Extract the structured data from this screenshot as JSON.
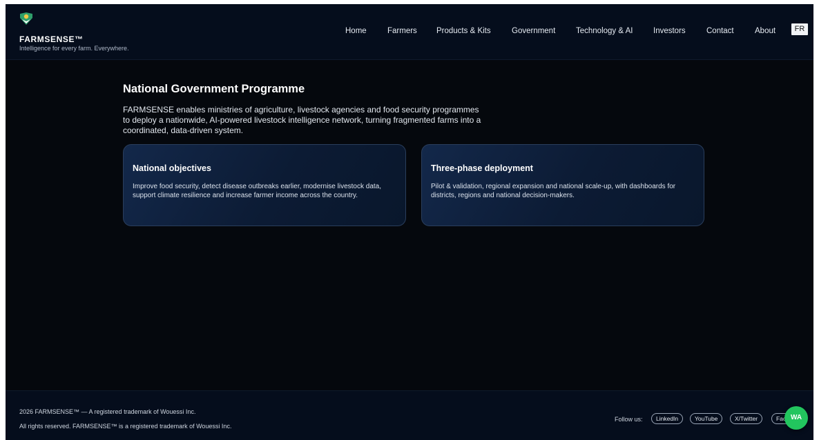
{
  "header": {
    "brand": "FARMSENSE™",
    "tagline": "Intelligence for every farm. Everywhere.",
    "nav": [
      "Home",
      "Farmers",
      "Products & Kits",
      "Government",
      "Technology & AI",
      "Investors",
      "Contact",
      "About"
    ],
    "lang_button": "FR"
  },
  "main": {
    "title": "National Government Programme",
    "intro": "FARMSENSE enables ministries of agriculture, livestock agencies and food security programmes to deploy a nationwide, AI-powered livestock intelligence network, turning fragmented farms into a coordinated, data-driven system.",
    "cards": [
      {
        "title": "National objectives",
        "body": "Improve food security, detect disease outbreaks earlier, modernise livestock data, support climate resilience and increase farmer income across the country."
      },
      {
        "title": "Three-phase deployment",
        "body": "Pilot & validation, regional expansion and national scale-up, with dashboards for districts, regions and national decision-makers."
      }
    ]
  },
  "footer": {
    "line1": "2026 FARMSENSE™ — A registered trademark of Wouessi Inc.",
    "line2": "All rights reserved. FARMSENSE™ is a registered trademark of Wouessi Inc.",
    "follow_label": "Follow us:",
    "social": [
      "LinkedIn",
      "YouTube",
      "X/Twitter",
      "Face"
    ]
  },
  "floating": {
    "wa_label": "WA"
  },
  "colors": {
    "background": "#05080d",
    "header_bg": "#050d1c",
    "card_border": "#2a3e5c",
    "wa_green": "#22c55e",
    "logo_green": "#2f9e6b",
    "logo_gold": "#f2c744"
  },
  "icons": {
    "logo": "farmsense-logo-icon"
  }
}
